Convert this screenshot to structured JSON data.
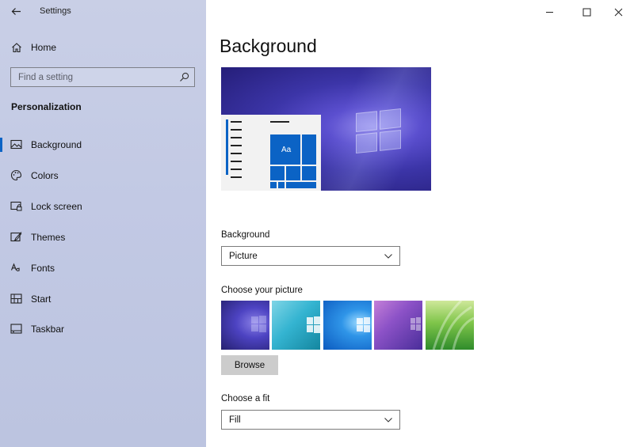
{
  "window": {
    "title": "Settings"
  },
  "sidebar": {
    "home_label": "Home",
    "search_placeholder": "Find a setting",
    "section_title": "Personalization",
    "items": [
      {
        "label": "Background",
        "icon": "picture-icon",
        "selected": true
      },
      {
        "label": "Colors",
        "icon": "palette-icon",
        "selected": false
      },
      {
        "label": "Lock screen",
        "icon": "lock-screen-icon",
        "selected": false
      },
      {
        "label": "Themes",
        "icon": "themes-icon",
        "selected": false
      },
      {
        "label": "Fonts",
        "icon": "fonts-icon",
        "selected": false
      },
      {
        "label": "Start",
        "icon": "start-icon",
        "selected": false
      },
      {
        "label": "Taskbar",
        "icon": "taskbar-icon",
        "selected": false
      }
    ]
  },
  "main": {
    "page_title": "Background",
    "preview_tile_text": "Aa",
    "background_label": "Background",
    "background_value": "Picture",
    "choose_picture_label": "Choose your picture",
    "browse_label": "Browse",
    "fit_label": "Choose a fit",
    "fit_value": "Fill"
  },
  "colors": {
    "accent": "#0b63c5",
    "sidebar_bg": "#c2c9e4"
  }
}
